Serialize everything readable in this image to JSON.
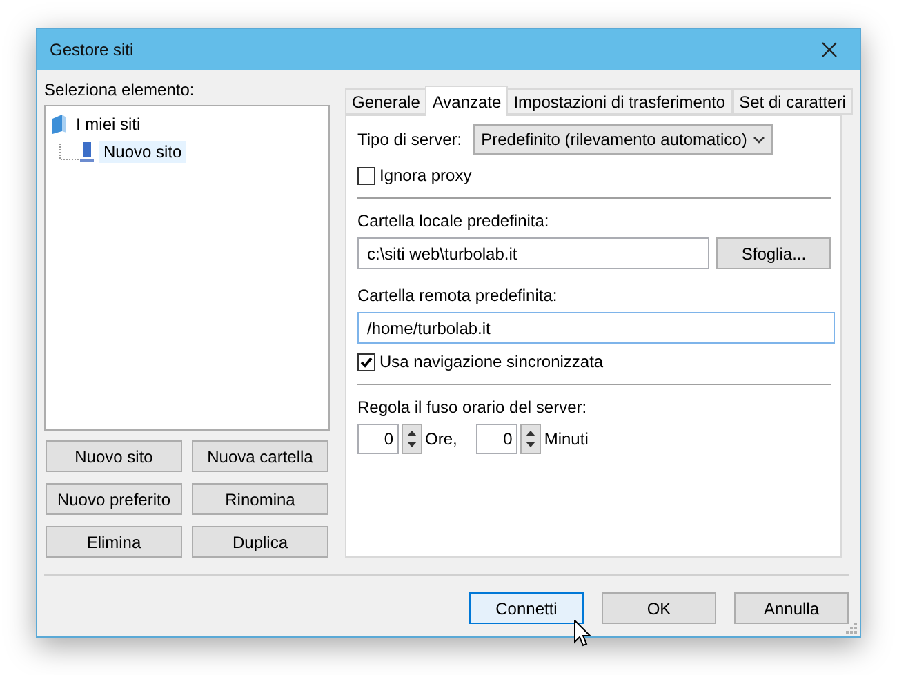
{
  "window": {
    "title": "Gestore siti"
  },
  "site_tree": {
    "label": "Seleziona elemento:",
    "items": [
      {
        "label": "I miei siti",
        "selected": false,
        "expanded": true,
        "children": [
          {
            "label": "Nuovo sito",
            "selected": true
          }
        ]
      }
    ]
  },
  "site_buttons": [
    "Nuovo sito",
    "Nuova cartella",
    "Nuovo preferito",
    "Rinomina",
    "Elimina",
    "Duplica"
  ],
  "tabs": [
    {
      "label": "Generale",
      "selected": false
    },
    {
      "label": "Avanzate",
      "selected": true
    },
    {
      "label": "Impostazioni di trasferimento",
      "selected": false
    },
    {
      "label": "Set di caratteri",
      "selected": false
    }
  ],
  "advanced": {
    "server_type": {
      "label": "Tipo di server:",
      "value": "Predefinito (rilevamento automatico)"
    },
    "ignore_proxy": {
      "label": "Ignora proxy",
      "checked": false
    },
    "local_folder": {
      "label": "Cartella locale predefinita:",
      "value": "c:\\siti web\\turbolab.it",
      "button": "Sfoglia..."
    },
    "remote_folder": {
      "label": "Cartella remota predefinita:",
      "value": "/home/turbolab.it",
      "focused": true
    },
    "sync_browsing": {
      "label": "Usa navigazione sincronizzata",
      "checked": true
    },
    "timezone": {
      "label": "Regola il fuso orario del server:",
      "hours": {
        "value": "0",
        "unit": "Ore,"
      },
      "minutes": {
        "value": "0",
        "unit": "Minuti"
      }
    }
  },
  "buttons": [
    {
      "label": "Connetti",
      "hovered": true
    },
    {
      "label": "OK",
      "hovered": false
    },
    {
      "label": "Annulla",
      "hovered": false
    }
  ]
}
